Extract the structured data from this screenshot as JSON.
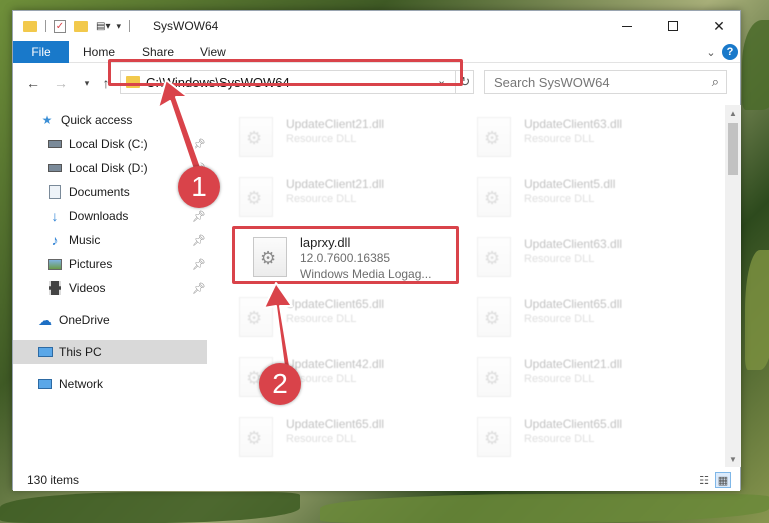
{
  "window": {
    "title": "SysWOW64"
  },
  "ribbon": {
    "tabs": [
      "File",
      "Home",
      "Share",
      "View"
    ]
  },
  "address": {
    "path": "C:\\Windows\\SysWOW64"
  },
  "search": {
    "placeholder": "Search SysWOW64"
  },
  "sidebar": {
    "items": [
      {
        "label": "Quick access",
        "icon": "star-icon",
        "pinned": false
      },
      {
        "label": "Local Disk (C:)",
        "icon": "drive-icon",
        "pinned": true
      },
      {
        "label": "Local Disk (D:)",
        "icon": "drive-icon",
        "pinned": true
      },
      {
        "label": "Documents",
        "icon": "documents-icon",
        "pinned": true
      },
      {
        "label": "Downloads",
        "icon": "download-icon",
        "pinned": true
      },
      {
        "label": "Music",
        "icon": "music-icon",
        "pinned": true
      },
      {
        "label": "Pictures",
        "icon": "pictures-icon",
        "pinned": true
      },
      {
        "label": "Videos",
        "icon": "videos-icon",
        "pinned": true
      },
      {
        "label": "OneDrive",
        "icon": "cloud-icon",
        "pinned": false
      },
      {
        "label": "This PC",
        "icon": "computer-icon",
        "pinned": false,
        "selected": true
      },
      {
        "label": "Network",
        "icon": "network-icon",
        "pinned": false
      }
    ]
  },
  "files": {
    "left": [
      {
        "name": "UpdateClient21.dll",
        "type": "Resource DLL"
      },
      {
        "name": "UpdateClient21.dll",
        "type": "Resource DLL"
      },
      {
        "name": "laprxy.dll",
        "version": "12.0.7600.16385",
        "description": "Windows Media Logag..."
      },
      {
        "name": "UpdateClient65.dll",
        "type": "Resource DLL"
      },
      {
        "name": "UpdateClient42.dll",
        "type": "Resource DLL"
      },
      {
        "name": "UpdateClient65.dll",
        "type": "Resource DLL"
      }
    ],
    "right": [
      {
        "name": "UpdateClient63.dll",
        "type": "Resource DLL"
      },
      {
        "name": "UpdateClient5.dll",
        "type": "Resource DLL"
      },
      {
        "name": "UpdateClient63.dll",
        "type": "Resource DLL"
      },
      {
        "name": "UpdateClient65.dll",
        "type": "Resource DLL"
      },
      {
        "name": "UpdateClient21.dll",
        "type": "Resource DLL"
      },
      {
        "name": "UpdateClient65.dll",
        "type": "Resource DLL"
      }
    ]
  },
  "status": {
    "item_count": "130 items"
  },
  "annotations": {
    "step1": "1",
    "step2": "2",
    "color": "#d9434a"
  }
}
